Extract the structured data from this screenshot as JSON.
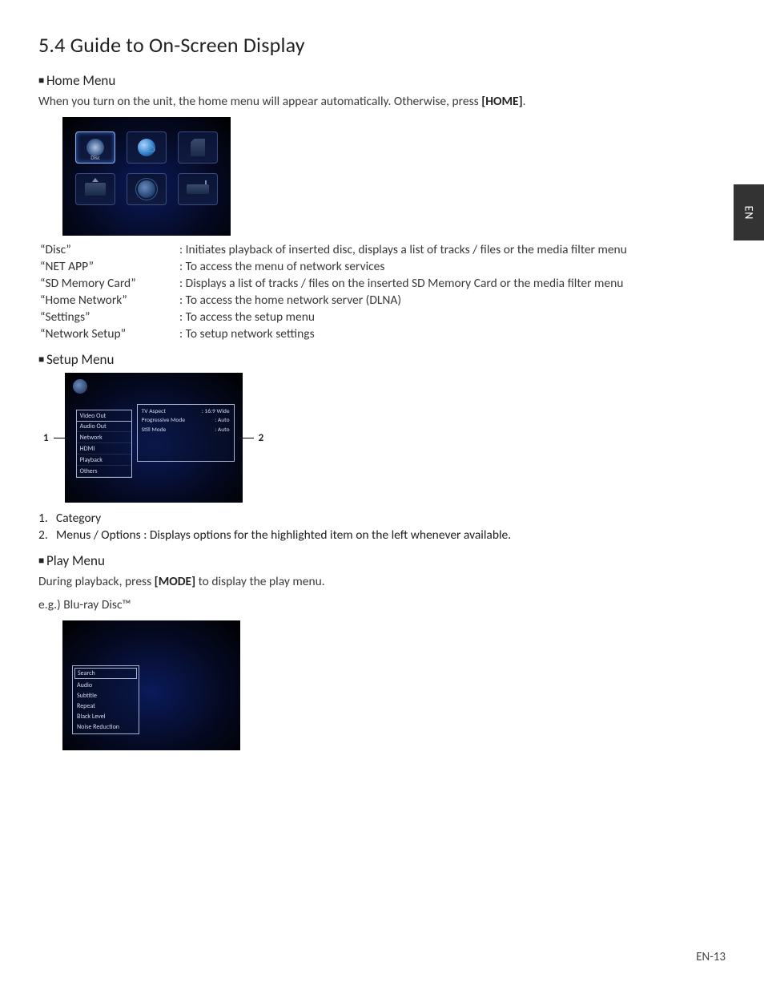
{
  "page": {
    "title": "5.4   Guide to On-Screen Display",
    "lang_tab": "EN",
    "page_number": "EN-13"
  },
  "home": {
    "heading": "Home Menu",
    "intro_pre": "When you turn on the unit, the home menu will appear automatically. Otherwise, press ",
    "intro_key": "[HOME]",
    "intro_post": ".",
    "disc_label": "Disc",
    "defs": [
      {
        "term": "“Disc”",
        "desc": ": Initiates playback of inserted disc, displays a list of tracks / files or the media filter menu"
      },
      {
        "term": "“NET APP”",
        "desc": ": To access the menu of network services"
      },
      {
        "term": "“SD Memory Card”",
        "desc": ": Displays a list of tracks / files on the inserted SD Memory Card or the media filter menu"
      },
      {
        "term": "“Home Network”",
        "desc": ": To access the home network server (DLNA)"
      },
      {
        "term": "“Settings”",
        "desc": ": To access the setup menu"
      },
      {
        "term": "“Network Setup”",
        "desc": ": To setup network settings"
      }
    ]
  },
  "setup": {
    "heading": "Setup Menu",
    "callout_left": "1",
    "callout_right": "2",
    "left_items": [
      "Video Out",
      "Audio Out",
      "Network",
      "HDMI",
      "Playback",
      "Others"
    ],
    "right_items": [
      {
        "k": "TV Aspect",
        "v": ": 16:9 Wide"
      },
      {
        "k": "Progressive Mode",
        "v": ": Auto"
      },
      {
        "k": "Still Mode",
        "v": ": Auto"
      }
    ],
    "list": [
      {
        "n": "1.",
        "label": "Category",
        "desc": ""
      },
      {
        "n": "2.",
        "label": "Menus / Options",
        "desc": ": Displays options for the highlighted item on the left whenever available."
      }
    ]
  },
  "play": {
    "heading": "Play Menu",
    "intro_pre": "During playback, press ",
    "intro_key": "[MODE]",
    "intro_post": " to display the play menu.",
    "example": "e.g.) Blu-ray Disc™",
    "items": [
      "Search",
      "Audio",
      "Subtitle",
      "Repeat",
      "Black Level",
      "Noise Reduction"
    ]
  }
}
